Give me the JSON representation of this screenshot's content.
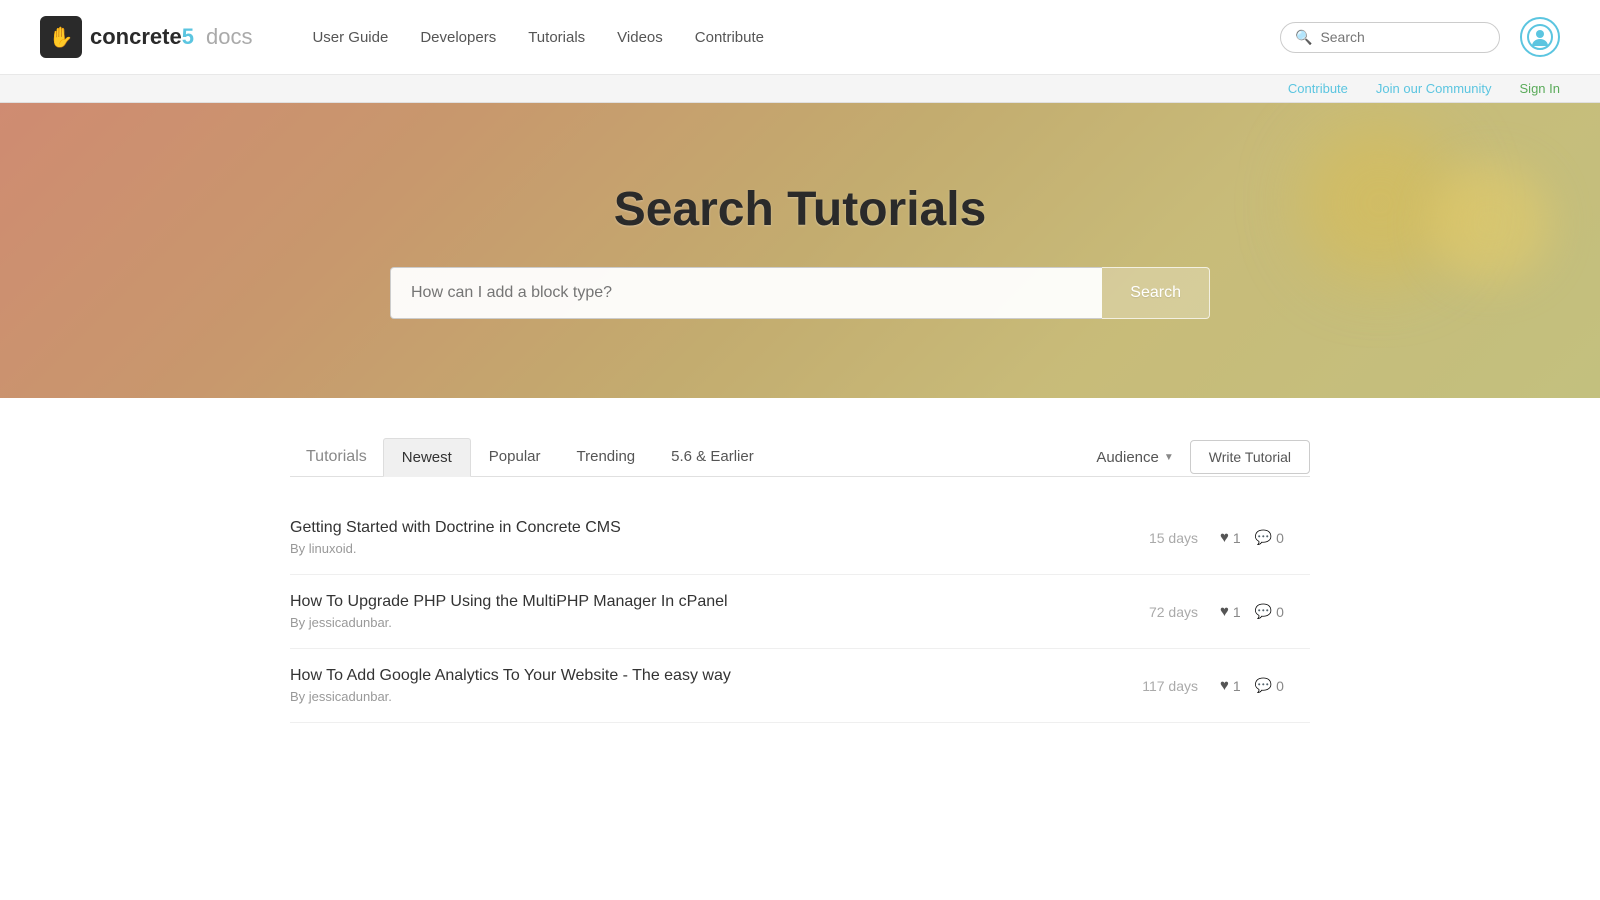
{
  "site": {
    "brand_name": "concrete5",
    "brand_num": "5",
    "brand_docs": "docs",
    "logo_icon": "✋"
  },
  "nav": {
    "links": [
      {
        "id": "user-guide",
        "label": "User Guide"
      },
      {
        "id": "developers",
        "label": "Developers"
      },
      {
        "id": "tutorials",
        "label": "Tutorials"
      },
      {
        "id": "videos",
        "label": "Videos"
      },
      {
        "id": "contribute",
        "label": "Contribute"
      }
    ],
    "search_placeholder": "Search"
  },
  "sub_nav": {
    "contribute_label": "Contribute",
    "community_label": "Join our Community",
    "signin_label": "Sign In"
  },
  "hero": {
    "title": "Search Tutorials",
    "search_placeholder": "How can I add a block type?",
    "search_btn": "Search"
  },
  "content": {
    "tabs": [
      {
        "id": "tutorials-label",
        "label": "Tutorials",
        "active": false
      },
      {
        "id": "newest",
        "label": "Newest",
        "active": true
      },
      {
        "id": "popular",
        "label": "Popular",
        "active": false
      },
      {
        "id": "trending",
        "label": "Trending",
        "active": false
      },
      {
        "id": "older",
        "label": "5.6 & Earlier",
        "active": false
      }
    ],
    "audience_label": "Audience",
    "write_tutorial_label": "Write Tutorial",
    "tutorials": [
      {
        "id": "tutorial-1",
        "title": "Getting Started with Doctrine in Concrete CMS",
        "author": "By linuxoid.",
        "days": "15 days",
        "likes": "1",
        "comments": "0"
      },
      {
        "id": "tutorial-2",
        "title": "How To Upgrade PHP Using the MultiPHP Manager In cPanel",
        "author": "By jessicadunbar.",
        "days": "72 days",
        "likes": "1",
        "comments": "0"
      },
      {
        "id": "tutorial-3",
        "title": "How To Add Google Analytics To Your Website - The easy way",
        "author": "By jessicadunbar.",
        "days": "117 days",
        "likes": "1",
        "comments": "0"
      }
    ]
  }
}
